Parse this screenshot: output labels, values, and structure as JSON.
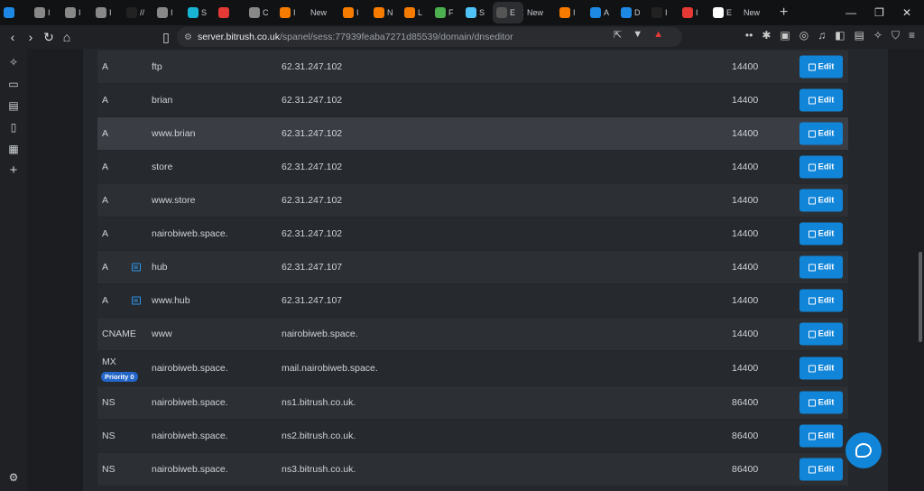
{
  "browser": {
    "tabs": [
      {
        "label": "",
        "color": "#1e88e5"
      },
      {
        "label": "I",
        "color": "#888888"
      },
      {
        "label": "I",
        "color": "#888888"
      },
      {
        "label": "I",
        "color": "#888888"
      },
      {
        "label": "//",
        "color": "#222222"
      },
      {
        "label": "I",
        "color": "#888888"
      },
      {
        "label": "S",
        "color": "#19b3d4"
      },
      {
        "label": "",
        "color": "#e53935"
      },
      {
        "label": "C",
        "color": "#888888"
      },
      {
        "label": "I",
        "color": "#f57c00"
      },
      {
        "label": "New",
        "color": ""
      },
      {
        "label": "I",
        "color": "#f57c00"
      },
      {
        "label": "N",
        "color": "#f57c00"
      },
      {
        "label": "L",
        "color": "#f57c00"
      },
      {
        "label": "F",
        "color": "#4caf50"
      },
      {
        "label": "S",
        "color": "#4fc3f7"
      },
      {
        "label": "E",
        "color": "#555555"
      },
      {
        "label": "New",
        "color": ""
      },
      {
        "label": "I",
        "color": "#f57c00"
      },
      {
        "label": "A",
        "color": "#1e88e5"
      },
      {
        "label": "D",
        "color": "#1e88e5"
      },
      {
        "label": "I",
        "color": "#222222"
      },
      {
        "label": "I",
        "color": "#e53935"
      },
      {
        "label": "E",
        "color": "#ffffff"
      },
      {
        "label": "New",
        "color": ""
      }
    ],
    "url_host": "server.bitrush.co.uk",
    "url_path": "/spanel/sess:77939feaba7271d85539/domain/dnseditor"
  },
  "records": [
    {
      "type": "A",
      "name": "ftp",
      "record": "62.31.247.102",
      "ttl": "14400",
      "comment": false,
      "priority": ""
    },
    {
      "type": "A",
      "name": "brian",
      "record": "62.31.247.102",
      "ttl": "14400",
      "comment": false,
      "priority": ""
    },
    {
      "type": "A",
      "name": "www.brian",
      "record": "62.31.247.102",
      "ttl": "14400",
      "comment": false,
      "priority": ""
    },
    {
      "type": "A",
      "name": "store",
      "record": "62.31.247.102",
      "ttl": "14400",
      "comment": false,
      "priority": ""
    },
    {
      "type": "A",
      "name": "www.store",
      "record": "62.31.247.102",
      "ttl": "14400",
      "comment": false,
      "priority": ""
    },
    {
      "type": "A",
      "name": "nairobiweb.space.",
      "record": "62.31.247.102",
      "ttl": "14400",
      "comment": false,
      "priority": ""
    },
    {
      "type": "A",
      "name": "hub",
      "record": "62.31.247.107",
      "ttl": "14400",
      "comment": true,
      "priority": ""
    },
    {
      "type": "A",
      "name": "www.hub",
      "record": "62.31.247.107",
      "ttl": "14400",
      "comment": true,
      "priority": ""
    },
    {
      "type": "CNAME",
      "name": "www",
      "record": "nairobiweb.space.",
      "ttl": "14400",
      "comment": false,
      "priority": ""
    },
    {
      "type": "MX",
      "name": "nairobiweb.space.",
      "record": "mail.nairobiweb.space.",
      "ttl": "14400",
      "comment": false,
      "priority": "Priority 0"
    },
    {
      "type": "NS",
      "name": "nairobiweb.space.",
      "record": "ns1.bitrush.co.uk.",
      "ttl": "86400",
      "comment": false,
      "priority": ""
    },
    {
      "type": "NS",
      "name": "nairobiweb.space.",
      "record": "ns2.bitrush.co.uk.",
      "ttl": "86400",
      "comment": false,
      "priority": ""
    },
    {
      "type": "NS",
      "name": "nairobiweb.space.",
      "record": "ns3.bitrush.co.uk.",
      "ttl": "86400",
      "comment": false,
      "priority": ""
    }
  ],
  "edit_label": "Edit",
  "colors": {
    "accent": "#1185d8",
    "badge": "#2467c9",
    "comment_icon": "#2f93e6"
  }
}
